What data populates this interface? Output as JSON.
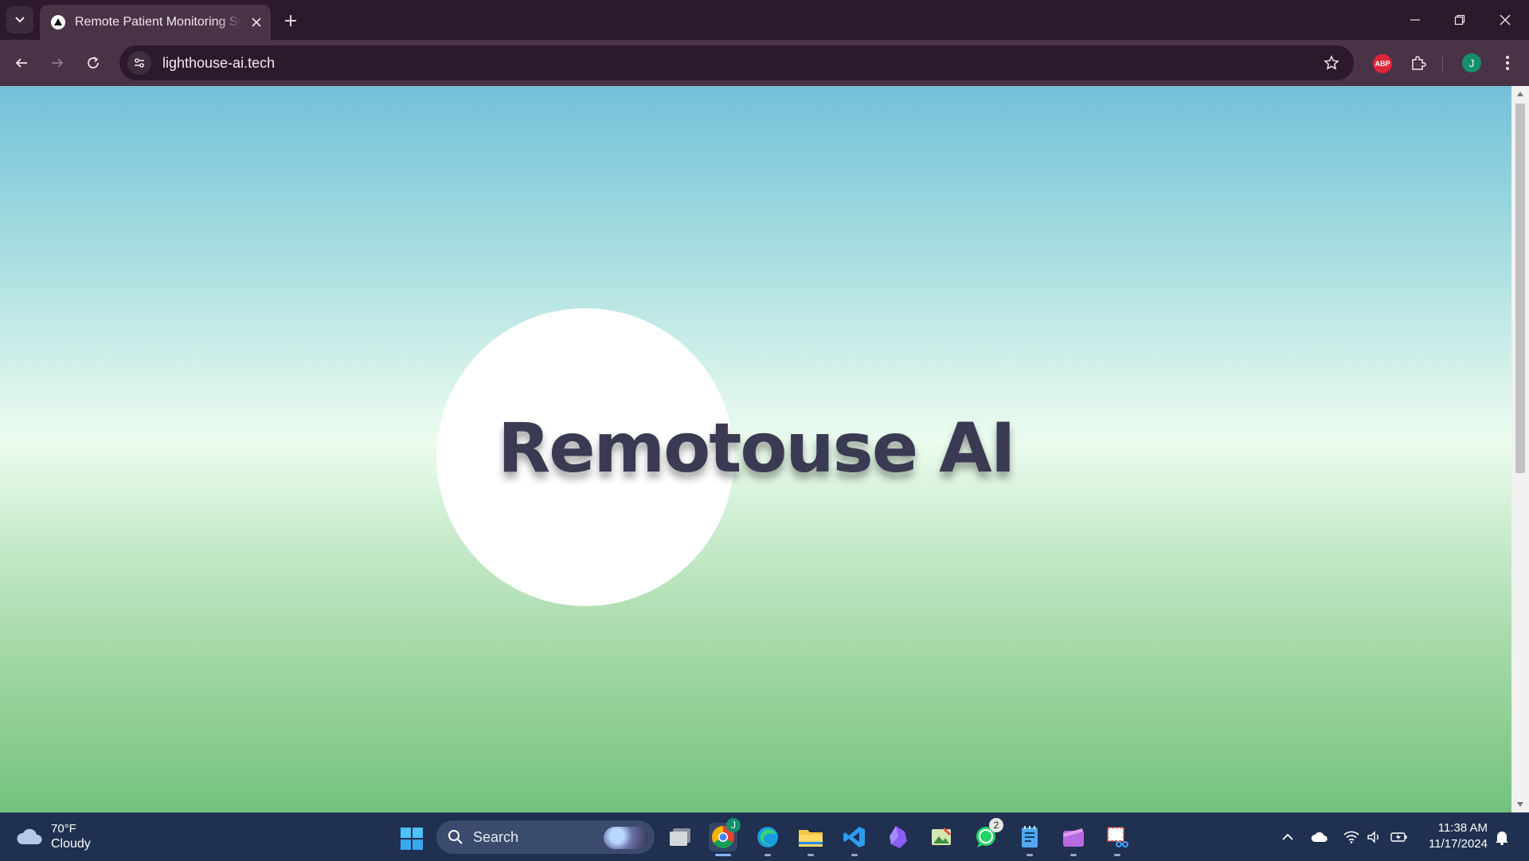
{
  "browser": {
    "tab_title": "Remote Patient Monitoring System",
    "url": "lighthouse-ai.tech",
    "profile_initial": "J",
    "abp_label": "ABP"
  },
  "page": {
    "hero_title": "Remotouse AI"
  },
  "taskbar": {
    "weather_temp": "70°F",
    "weather_condition": "Cloudy",
    "search_label": "Search",
    "whatsapp_badge": "2",
    "chrome_badge": "J",
    "time": "11:38 AM",
    "date": "11/17/2024"
  },
  "colors": {
    "titlebar": "#2c1a2c",
    "toolbar": "#4a3347",
    "taskbar": "#1f3050",
    "hero_text": "#3a3a52"
  }
}
